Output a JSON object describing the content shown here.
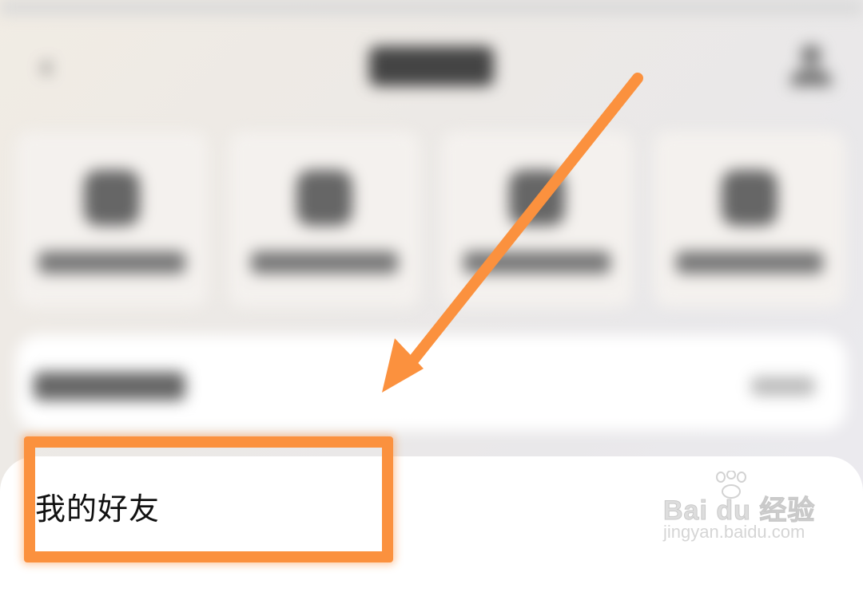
{
  "friends_item": {
    "label": "我的好友"
  },
  "annotation": {
    "color": "#fb913e"
  },
  "watermark": {
    "brand": "Bai du 经验",
    "url": "jingyan.baidu.com"
  },
  "icons": {
    "back": "back-chevron-icon",
    "user": "user-icon",
    "tiles": [
      "app-icon",
      "game-icon",
      "app-icon",
      "app-icon"
    ]
  }
}
